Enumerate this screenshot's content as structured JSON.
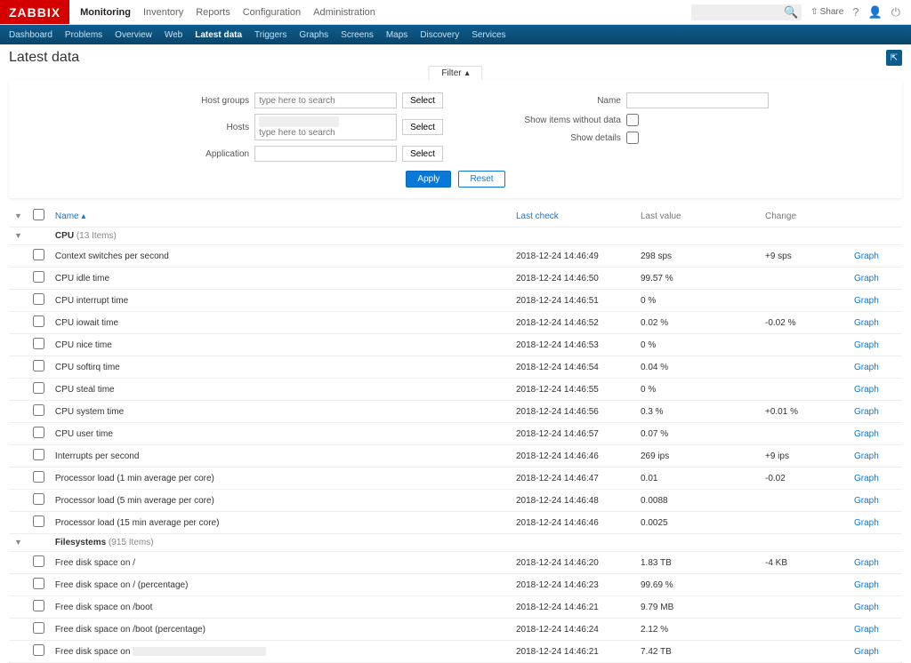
{
  "logo": "ZABBIX",
  "main_nav": [
    "Monitoring",
    "Inventory",
    "Reports",
    "Configuration",
    "Administration"
  ],
  "main_nav_active": 0,
  "top_right": {
    "share": "Share",
    "help": "?"
  },
  "sub_nav": [
    "Dashboard",
    "Problems",
    "Overview",
    "Web",
    "Latest data",
    "Triggers",
    "Graphs",
    "Screens",
    "Maps",
    "Discovery",
    "Services"
  ],
  "sub_nav_active": 4,
  "page_title": "Latest data",
  "filter_tab": "Filter",
  "filter": {
    "host_groups_label": "Host groups",
    "host_groups_placeholder": "type here to search",
    "hosts_label": "Hosts",
    "hosts_placeholder": "type here to search",
    "application_label": "Application",
    "name_label": "Name",
    "show_without_label": "Show items without data",
    "show_details_label": "Show details",
    "select_btn": "Select",
    "apply_btn": "Apply",
    "reset_btn": "Reset"
  },
  "columns": {
    "name": "Name",
    "last_check": "Last check",
    "last_value": "Last value",
    "change": "Change"
  },
  "action_label": "Graph",
  "groups": [
    {
      "name": "CPU",
      "count": "13 Items",
      "rows": [
        {
          "name": "Context switches per second",
          "lc": "2018-12-24 14:46:49",
          "lv": "298 sps",
          "ch": "+9 sps",
          "a": true
        },
        {
          "name": "CPU idle time",
          "lc": "2018-12-24 14:46:50",
          "lv": "99.57 %",
          "ch": "",
          "a": true
        },
        {
          "name": "CPU interrupt time",
          "lc": "2018-12-24 14:46:51",
          "lv": "0 %",
          "ch": "",
          "a": true
        },
        {
          "name": "CPU iowait time",
          "lc": "2018-12-24 14:46:52",
          "lv": "0.02 %",
          "ch": "-0.02 %",
          "a": true
        },
        {
          "name": "CPU nice time",
          "lc": "2018-12-24 14:46:53",
          "lv": "0 %",
          "ch": "",
          "a": true
        },
        {
          "name": "CPU softirq time",
          "lc": "2018-12-24 14:46:54",
          "lv": "0.04 %",
          "ch": "",
          "a": true
        },
        {
          "name": "CPU steal time",
          "lc": "2018-12-24 14:46:55",
          "lv": "0 %",
          "ch": "",
          "a": true
        },
        {
          "name": "CPU system time",
          "lc": "2018-12-24 14:46:56",
          "lv": "0.3 %",
          "ch": "+0.01 %",
          "a": true
        },
        {
          "name": "CPU user time",
          "lc": "2018-12-24 14:46:57",
          "lv": "0.07 %",
          "ch": "",
          "a": true
        },
        {
          "name": "Interrupts per second",
          "lc": "2018-12-24 14:46:46",
          "lv": "269 ips",
          "ch": "+9 ips",
          "a": true
        },
        {
          "name": "Processor load (1 min average per core)",
          "lc": "2018-12-24 14:46:47",
          "lv": "0.01",
          "ch": "-0.02",
          "a": true
        },
        {
          "name": "Processor load (5 min average per core)",
          "lc": "2018-12-24 14:46:48",
          "lv": "0.0088",
          "ch": "",
          "a": true
        },
        {
          "name": "Processor load (15 min average per core)",
          "lc": "2018-12-24 14:46:46",
          "lv": "0.0025",
          "ch": "",
          "a": true
        }
      ]
    },
    {
      "name": "Filesystems",
      "count": "915 Items",
      "rows": [
        {
          "name": "Free disk space on /",
          "lc": "2018-12-24 14:46:20",
          "lv": "1.83 TB",
          "ch": "-4 KB",
          "a": true
        },
        {
          "name": "Free disk space on / (percentage)",
          "lc": "2018-12-24 14:46:23",
          "lv": "99.69 %",
          "ch": "",
          "a": true
        },
        {
          "name": "Free disk space on /boot",
          "lc": "2018-12-24 14:46:21",
          "lv": "9.79 MB",
          "ch": "",
          "a": true
        },
        {
          "name": "Free disk space on /boot (percentage)",
          "lc": "2018-12-24 14:46:24",
          "lv": "2.12 %",
          "ch": "",
          "a": true
        },
        {
          "name": "Free disk space on",
          "lc": "2018-12-24 14:46:21",
          "lv": "7.42 TB",
          "ch": "",
          "a": true,
          "redacted": true
        }
      ]
    }
  ]
}
